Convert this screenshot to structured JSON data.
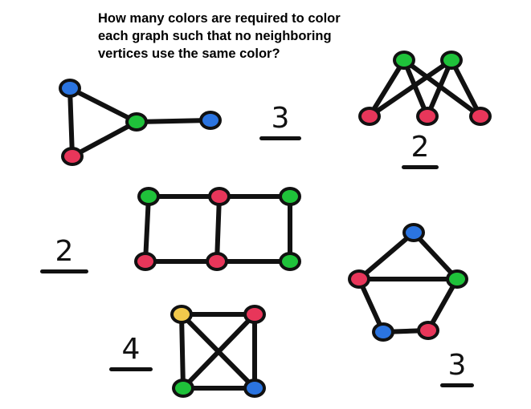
{
  "question": {
    "lines": [
      "How many colors are required to color",
      "each graph such that no neighboring",
      "vertices use the same color?"
    ]
  },
  "colors": {
    "red": "#e8365a",
    "green": "#1fc23a",
    "blue": "#2b74e0",
    "yellow": "#f2c94c",
    "edge": "#111111"
  },
  "graphs": [
    {
      "id": "triangle-with-tail",
      "answer": "3",
      "vertex_colors": [
        "blue",
        "red",
        "green",
        "blue"
      ],
      "edges": [
        [
          0,
          1
        ],
        [
          0,
          2
        ],
        [
          1,
          2
        ],
        [
          2,
          3
        ]
      ]
    },
    {
      "id": "bipartite-2x3",
      "answer": "2",
      "vertex_colors": [
        "green",
        "green",
        "red",
        "red",
        "red"
      ],
      "edges": [
        [
          0,
          2
        ],
        [
          0,
          3
        ],
        [
          0,
          4
        ],
        [
          1,
          2
        ],
        [
          1,
          3
        ],
        [
          1,
          4
        ]
      ]
    },
    {
      "id": "double-square",
      "answer": "2",
      "vertex_colors": [
        "green",
        "red",
        "green",
        "red",
        "red",
        "green"
      ],
      "edges": [
        [
          0,
          1
        ],
        [
          1,
          2
        ],
        [
          3,
          4
        ],
        [
          4,
          5
        ],
        [
          0,
          3
        ],
        [
          1,
          4
        ],
        [
          2,
          5
        ]
      ]
    },
    {
      "id": "house",
      "answer": "3",
      "vertex_colors": [
        "blue",
        "red",
        "green",
        "blue",
        "red"
      ],
      "edges": [
        [
          0,
          1
        ],
        [
          0,
          2
        ],
        [
          1,
          2
        ],
        [
          1,
          3
        ],
        [
          3,
          4
        ],
        [
          4,
          2
        ]
      ]
    },
    {
      "id": "complete-k4",
      "answer": "4",
      "vertex_colors": [
        "yellow",
        "red",
        "green",
        "blue"
      ],
      "edges": [
        [
          0,
          1
        ],
        [
          0,
          2
        ],
        [
          0,
          3
        ],
        [
          1,
          2
        ],
        [
          1,
          3
        ],
        [
          2,
          3
        ]
      ]
    }
  ]
}
